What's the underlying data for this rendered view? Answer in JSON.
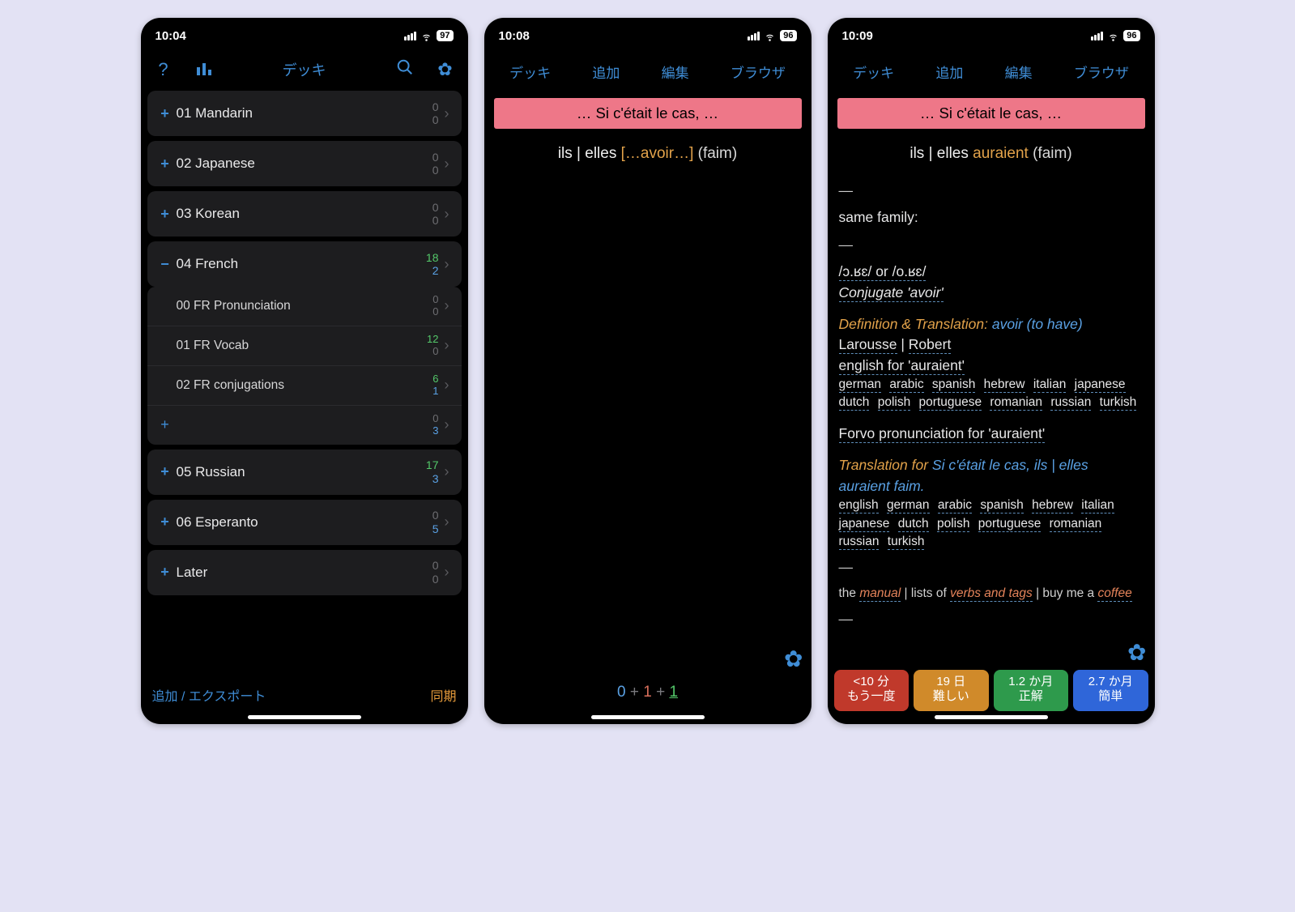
{
  "phone1": {
    "time": "10:04",
    "battery": "97",
    "toolbar_title": "デッキ",
    "decks": [
      {
        "name": "01 Mandarin",
        "top": "0",
        "bot": "0",
        "tc": "cnt-gray",
        "bc": "cnt-gray",
        "exp": "+"
      },
      {
        "name": "02 Japanese",
        "top": "0",
        "bot": "0",
        "tc": "cnt-gray",
        "bc": "cnt-gray",
        "exp": "+"
      },
      {
        "name": "03 Korean",
        "top": "0",
        "bot": "0",
        "tc": "cnt-gray",
        "bc": "cnt-gray",
        "exp": "+"
      }
    ],
    "french": {
      "name": "04 French",
      "top": "18",
      "bot": "2",
      "tc": "cnt-green",
      "bc": "cnt-blue",
      "exp": "−"
    },
    "french_subs": [
      {
        "name": "00 FR Pronunciation",
        "top": "0",
        "bot": "0",
        "tc": "cnt-gray",
        "bc": "cnt-gray"
      },
      {
        "name": "01 FR Vocab",
        "top": "12",
        "bot": "0",
        "tc": "cnt-green",
        "bc": "cnt-gray"
      },
      {
        "name": "02 FR conjugations",
        "top": "6",
        "bot": "1",
        "tc": "cnt-green",
        "bc": "cnt-blue"
      },
      {
        "name": "",
        "top": "0",
        "bot": "3",
        "tc": "cnt-gray",
        "bc": "cnt-blue",
        "add": true
      }
    ],
    "decks_after": [
      {
        "name": "05 Russian",
        "top": "17",
        "bot": "3",
        "tc": "cnt-green",
        "bc": "cnt-blue",
        "exp": "+"
      },
      {
        "name": "06 Esperanto",
        "top": "0",
        "bot": "5",
        "tc": "cnt-gray",
        "bc": "cnt-blue",
        "exp": "+"
      },
      {
        "name": "Later",
        "top": "0",
        "bot": "0",
        "tc": "cnt-gray",
        "bc": "cnt-gray",
        "exp": "+"
      }
    ],
    "bottom_left": "追加 / エクスポート",
    "bottom_right": "同期"
  },
  "phone2": {
    "time": "10:08",
    "battery": "96",
    "tabs": [
      "デッキ",
      "追加",
      "編集",
      "ブラウザ"
    ],
    "pink": "… Si c'était le cas, …",
    "prompt_pre": "ils | elles ",
    "prompt_cloze": "[…avoir…]",
    "prompt_post": " (faim)",
    "stats": {
      "a": "0",
      "b": "1",
      "c": "1"
    }
  },
  "phone3": {
    "time": "10:09",
    "battery": "96",
    "tabs": [
      "デッキ",
      "追加",
      "編集",
      "ブラウザ"
    ],
    "pink": "… Si c'était le cas, …",
    "prompt_pre": "ils | elles ",
    "prompt_word": "auraient",
    "prompt_post": " (faim)",
    "same_family": "same family:",
    "ipa": "/ɔ.ʁɛ/ or /o.ʁɛ/",
    "conjugate": "Conjugate 'avoir'",
    "def_head": "Definition & Translation: ",
    "def_word": "avoir (to have)",
    "larousse": "Larousse",
    "robert": "Robert",
    "english_for": "english for 'auraient'",
    "langs1": [
      "german",
      "arabic",
      "spanish",
      "hebrew",
      "italian",
      "japanese",
      "dutch",
      "polish",
      "portuguese",
      "romanian",
      "russian",
      "turkish"
    ],
    "forvo": "Forvo pronunciation for 'auraient'",
    "trans_head": "Translation for ",
    "trans_sentence": "Si c'était le cas, ils | elles auraient faim.",
    "langs2": [
      "english",
      "german",
      "arabic",
      "spanish",
      "hebrew",
      "italian",
      "japanese",
      "dutch",
      "polish",
      "portuguese",
      "romanian",
      "russian",
      "turkish"
    ],
    "footer_the": "the ",
    "footer_manual": "manual",
    "footer_lists": " | lists of ",
    "footer_verbs": "verbs and tags",
    "footer_buy": " | buy me a ",
    "footer_coffee": "coffee",
    "ease": [
      {
        "time": "<10 分",
        "label": "もう一度"
      },
      {
        "time": "19 日",
        "label": "難しい"
      },
      {
        "time": "1.2 か月",
        "label": "正解"
      },
      {
        "time": "2.7 か月",
        "label": "簡単"
      }
    ]
  }
}
